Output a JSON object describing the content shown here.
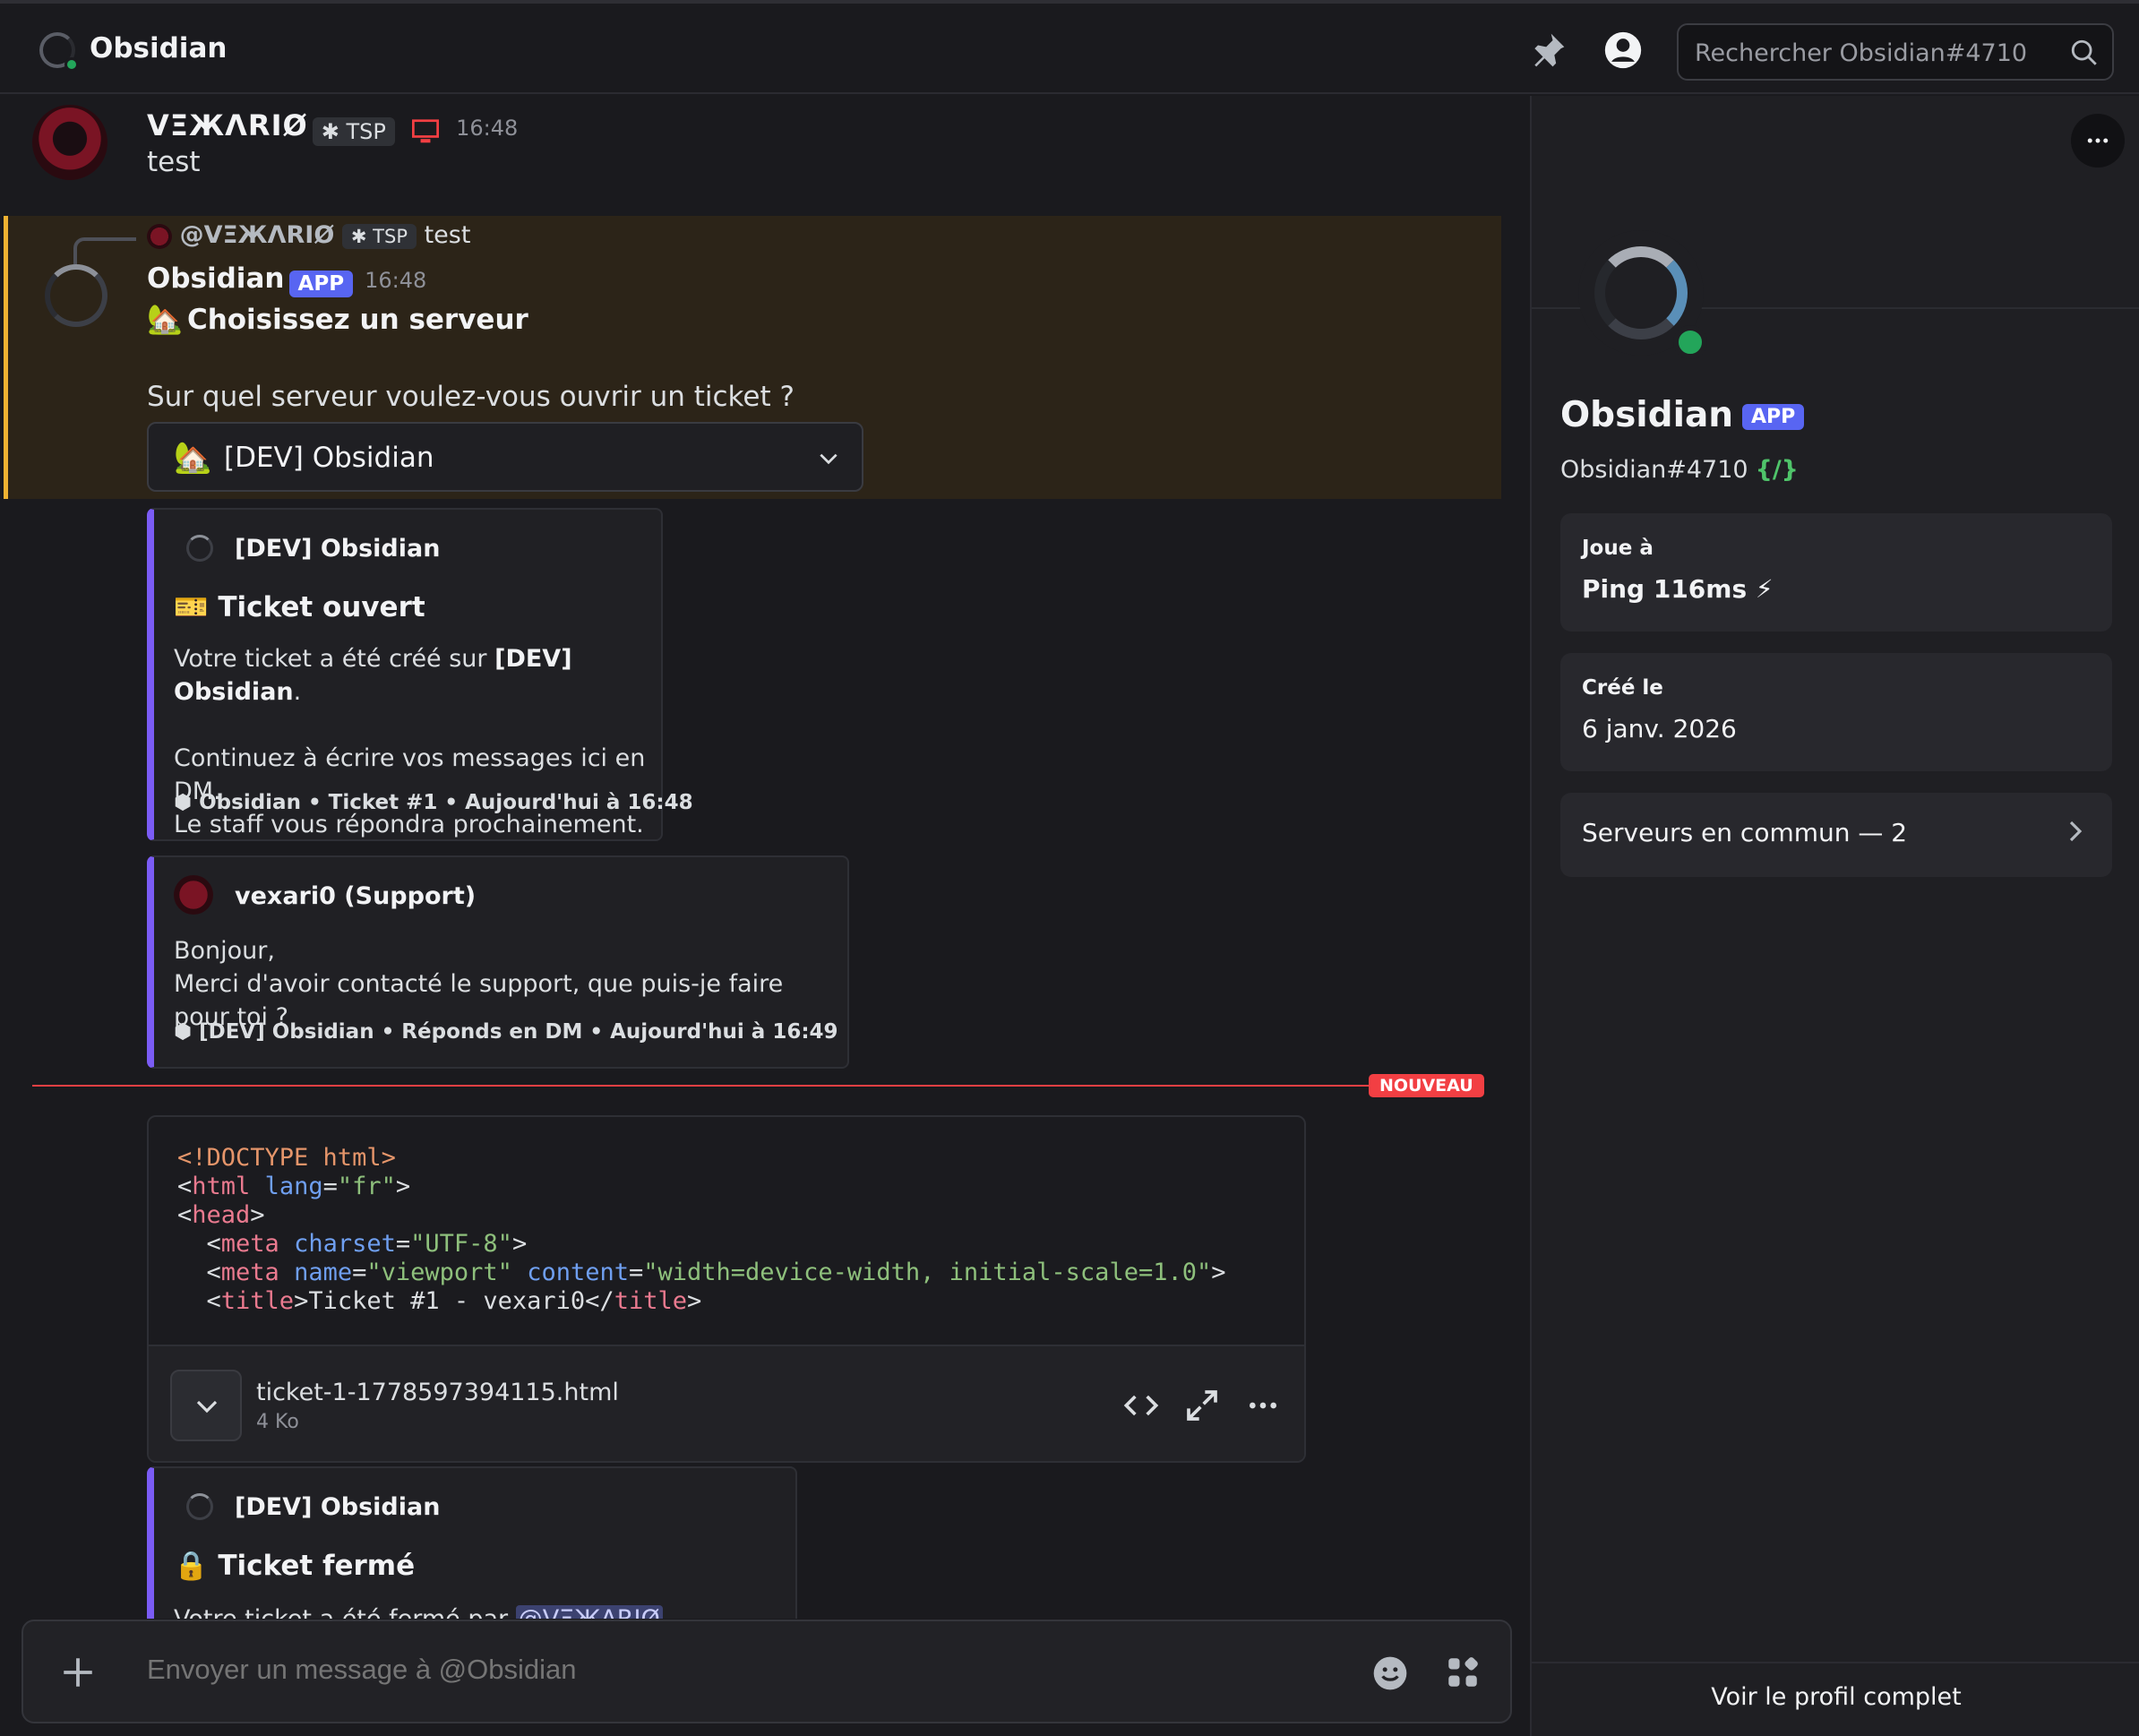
{
  "header": {
    "title": "Obsidian",
    "search_placeholder": "Rechercher Obsidian#4710"
  },
  "messages": {
    "first": {
      "username": "VΞЖΛRIØ",
      "tag": "TSP",
      "time": "16:48",
      "text": "test"
    },
    "reply": {
      "ref_user": "@VΞЖΛRIØ",
      "ref_tag": "TSP",
      "ref_text": "test",
      "username": "Obsidian",
      "badge": "APP",
      "time": "16:48",
      "title": "Choisissez un serveur",
      "question": "Sur quel serveur voulez-vous ouvrir un ticket ?",
      "select_value": "[DEV] Obsidian"
    },
    "embed_opened": {
      "author": "[DEV] Obsidian",
      "title": "Ticket ouvert",
      "desc_prefix": "Votre ticket a été créé sur ",
      "desc_bold": "[DEV] Obsidian",
      "desc_suffix": ".",
      "desc_line2": "Continuez à écrire vos messages ici en DM.",
      "desc_line3": "Le staff vous répondra prochainement.",
      "footer": "Obsidian • Ticket #1 • Aujourd'hui à 16:48"
    },
    "embed_support": {
      "author": "vexari0 (Support)",
      "line1": "Bonjour,",
      "line2": "Merci d'avoir contacté le support, que puis-je faire pour toi ?",
      "footer": "[DEV] Obsidian • Réponds en DM • Aujourd'hui à 16:49"
    },
    "new_divider": "NOUVEAU",
    "attachment": {
      "code_lines": [
        "<!DOCTYPE html>",
        "<html lang=\"fr\">",
        "<head>",
        "  <meta charset=\"UTF-8\">",
        "  <meta name=\"viewport\" content=\"width=device-width, initial-scale=1.0\">",
        "  <title>Ticket #1 - vexari0</title>"
      ],
      "filename": "ticket-1-1778597394115.html",
      "size": "4 Ko"
    },
    "embed_closed": {
      "author": "[DEV] Obsidian",
      "title": "Ticket fermé",
      "desc_prefix": "Votre ticket a été fermé par ",
      "mention": "@VΞЖΛRIØ",
      "desc_suffix": "."
    }
  },
  "composer": {
    "placeholder": "Envoyer un message à @Obsidian"
  },
  "profile": {
    "name": "Obsidian",
    "badge": "APP",
    "tag": "Obsidian#4710",
    "slash_icon": "{/}",
    "playing_label": "Joue à",
    "playing_value": "Ping 116ms ⚡",
    "created_label": "Créé le",
    "created_value": "6 janv. 2026",
    "mutual_servers": "Serveurs en commun — 2",
    "full_profile": "Voir le profil complet"
  },
  "colors": {
    "accent": "#5865f2",
    "embed_border": "#7b5cf5",
    "new_red": "#f23f43",
    "highlight": "#2c2418",
    "online": "#23a55a"
  }
}
